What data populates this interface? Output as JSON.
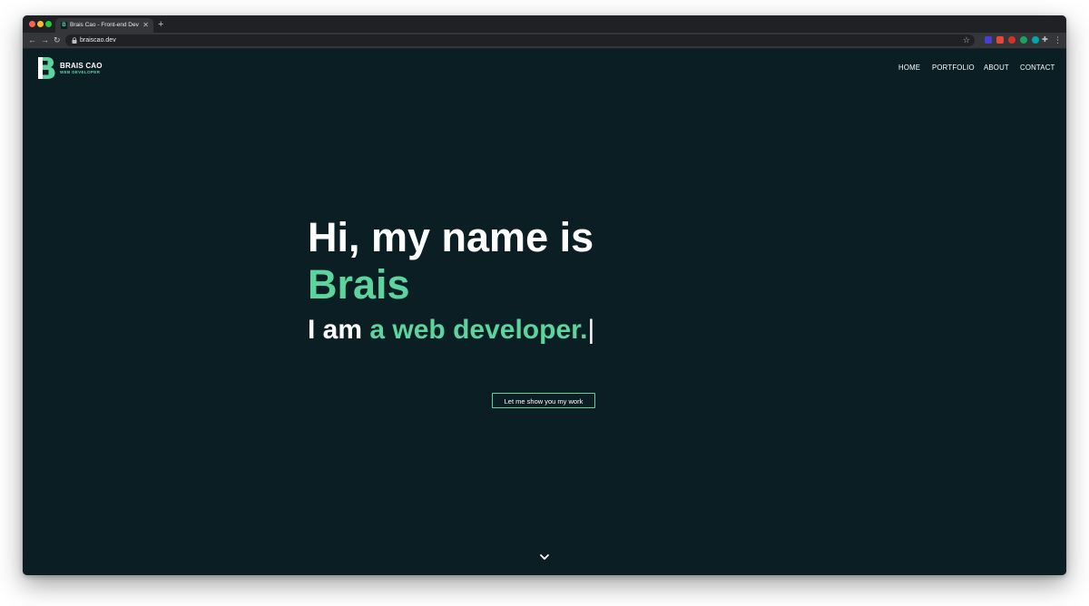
{
  "browser": {
    "tab": {
      "favicon": "logo-b-icon",
      "title": "Brais Cao - Front-end Dev",
      "close_icon": "close-icon"
    },
    "new_tab_icon": "plus-icon",
    "toolbar": {
      "back_icon": "arrow-left-icon",
      "forward_icon": "arrow-right-icon",
      "reload_icon": "reload-icon",
      "lock_icon": "lock-icon",
      "url": "braiscao.dev",
      "bookmark_icon": "star-icon",
      "extensions": [
        {
          "name": "extension-icon-1",
          "color": "#4a3cd6"
        },
        {
          "name": "extension-icon-2",
          "color": "#e8453c"
        },
        {
          "name": "extension-icon-3",
          "color": "#d93025"
        },
        {
          "name": "extension-icon-4",
          "color": "#1aa260"
        },
        {
          "name": "extension-icon-5",
          "color": "#00a8a8"
        },
        {
          "name": "puzzle-icon",
          "color": "#bdc1c6"
        }
      ],
      "menu_icon": "more-vertical-icon"
    }
  },
  "site": {
    "logo": {
      "mark": "logo-b-icon",
      "name": "BRAIS CAO",
      "role": "WEB DEVELOPER"
    },
    "nav": {
      "home": "HOME",
      "portfolio": "PORTFOLIO",
      "about": "ABOUT",
      "contact": "CONTACT"
    },
    "hero": {
      "line1": "Hi, my name is",
      "name": "Brais",
      "prefix": "I am ",
      "role": "a web developer.",
      "cursor": "|"
    },
    "cta_label": "Let me show you my work",
    "scroll_icon": "chevron-down-icon"
  },
  "colors": {
    "background": "#0b1e24",
    "accent": "#5dd39e",
    "text": "#ffffff",
    "chrome_dark": "#202124",
    "chrome_toolbar": "#35363a"
  }
}
